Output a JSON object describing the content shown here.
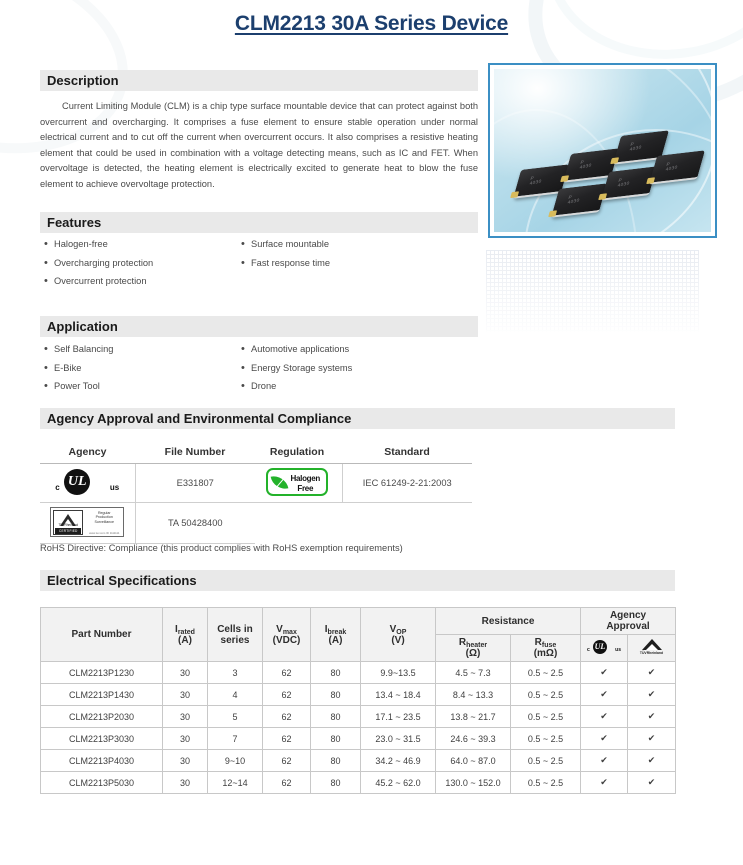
{
  "title": "CLM2213 30A Series Device",
  "sections": {
    "description": {
      "heading": "Description",
      "body": "Current Limiting Module (CLM) is a chip type surface mountable device that can protect against both overcurrent and overcharging. It comprises a fuse element to ensure stable operation under normal electrical current and to cut off the current when overcurrent occurs. It also comprises a resistive heating element that could be used in combination with a voltage detecting means, such as IC and FET. When overvoltage is detected, the heating element is electrically excited to generate heat to blow the fuse element to achieve overvoltage protection."
    },
    "features": {
      "heading": "Features",
      "left": [
        "Halogen-free",
        "Overcharging protection",
        "Overcurrent protection"
      ],
      "right": [
        "Surface mountable",
        "Fast response time"
      ]
    },
    "application": {
      "heading": "Application",
      "left": [
        "Self Balancing",
        "E-Bike",
        "Power Tool"
      ],
      "right": [
        "Automotive applications",
        "Energy Storage systems",
        "Drone"
      ]
    },
    "agency": {
      "heading": "Agency Approval and Environmental Compliance",
      "agency_header": "Agency",
      "file_number_header": "File Number",
      "regulation_header": "Regulation",
      "standard_header": "Standard",
      "rows": [
        {
          "logo": "ul-logo",
          "file_number": "E331807"
        },
        {
          "logo": "tuv-logo",
          "file_number": "TA 50428400"
        }
      ],
      "regulation_rows": [
        {
          "logo": "halogen-free-logo",
          "standard": "IEC 61249-2-21:2003"
        }
      ],
      "rohs_note": "RoHS Directive: Compliance (this product complies with RoHS exemption requirements)"
    },
    "electrical": {
      "heading": "Electrical Specifications"
    }
  },
  "product_image": {
    "alt": "CLM2213 surface mount chip devices",
    "chip_label_top": "P",
    "chip_label_bottom": "4030",
    "border_color": "#3b8fc4"
  },
  "logos": {
    "ul": {
      "c": "c",
      "mark": "UL",
      "us": "us"
    },
    "tuv": {
      "brand": "TÜVRheinland",
      "certified": "CERTIFIED",
      "line1": "Regular",
      "line2": "Production",
      "line3": "Surveillance",
      "url": "www.tuv.com\nID 1111111"
    },
    "halogen_free": {
      "line1": "Halogen",
      "line2": "Free"
    }
  },
  "chart_data": {
    "type": "table",
    "title": "Electrical Specifications",
    "group_headers": [
      {
        "label": "Part Number",
        "rowspan": 2
      },
      {
        "label": "Irated (A)",
        "rowspan": 2
      },
      {
        "label": "Cells in series",
        "rowspan": 2
      },
      {
        "label": "Vmax (VDC)",
        "rowspan": 2
      },
      {
        "label": "Ibreak (A)",
        "rowspan": 2
      },
      {
        "label": "VOP (V)",
        "rowspan": 2
      },
      {
        "label": "Resistance",
        "colspan": 2
      },
      {
        "label": "Agency Approval",
        "colspan": 2
      }
    ],
    "columns": [
      {
        "main": "Part Number",
        "sub": ""
      },
      {
        "main": "I",
        "subscript": "rated",
        "unit": "(A)"
      },
      {
        "main": "Cells in",
        "line2": "series",
        "unit": ""
      },
      {
        "main": "V",
        "subscript": "max",
        "unit": "(VDC)"
      },
      {
        "main": "I",
        "subscript": "break",
        "unit": "(A)"
      },
      {
        "main": "V",
        "subscript": "OP",
        "unit": "(V)"
      },
      {
        "main": "R",
        "subscript": "heater",
        "unit": "(Ω)"
      },
      {
        "main": "R",
        "subscript": "fuse",
        "unit": "(mΩ)"
      },
      {
        "main": "ul-logo",
        "unit": ""
      },
      {
        "main": "tuv-logo",
        "unit": ""
      }
    ],
    "resistance_group": "Resistance",
    "agency_group_line1": "Agency",
    "agency_group_line2": "Approval",
    "rows": [
      {
        "part_number": "CLM2213P1230",
        "i_rated": "30",
        "cells": "3",
        "v_max": "62",
        "i_break": "80",
        "v_op": "9.9~13.5",
        "r_heater": "4.5 ~ 7.3",
        "r_fuse": "0.5 ~ 2.5",
        "ul": "✔",
        "tuv": "✔"
      },
      {
        "part_number": "CLM2213P1430",
        "i_rated": "30",
        "cells": "4",
        "v_max": "62",
        "i_break": "80",
        "v_op": "13.4 ~ 18.4",
        "r_heater": "8.4 ~ 13.3",
        "r_fuse": "0.5 ~ 2.5",
        "ul": "✔",
        "tuv": "✔"
      },
      {
        "part_number": "CLM2213P2030",
        "i_rated": "30",
        "cells": "5",
        "v_max": "62",
        "i_break": "80",
        "v_op": "17.1 ~ 23.5",
        "r_heater": "13.8 ~ 21.7",
        "r_fuse": "0.5 ~ 2.5",
        "ul": "✔",
        "tuv": "✔"
      },
      {
        "part_number": "CLM2213P3030",
        "i_rated": "30",
        "cells": "7",
        "v_max": "62",
        "i_break": "80",
        "v_op": "23.0 ~ 31.5",
        "r_heater": "24.6 ~ 39.3",
        "r_fuse": "0.5 ~ 2.5",
        "ul": "✔",
        "tuv": "✔"
      },
      {
        "part_number": "CLM2213P4030",
        "i_rated": "30",
        "cells": "9~10",
        "v_max": "62",
        "i_break": "80",
        "v_op": "34.2 ~ 46.9",
        "r_heater": "64.0 ~ 87.0",
        "r_fuse": "0.5 ~ 2.5",
        "ul": "✔",
        "tuv": "✔"
      },
      {
        "part_number": "CLM2213P5030",
        "i_rated": "30",
        "cells": "12~14",
        "v_max": "62",
        "i_break": "80",
        "v_op": "45.2 ~ 62.0",
        "r_heater": "130.0 ~ 152.0",
        "r_fuse": "0.5 ~ 2.5",
        "ul": "✔",
        "tuv": "✔"
      }
    ]
  },
  "colors": {
    "title": "#1c3f6e",
    "section_bar": "#e9e9e9",
    "table_header_bg": "#f2f2f2",
    "border": "#c8c8c8",
    "halogen_green": "#23b22a"
  }
}
